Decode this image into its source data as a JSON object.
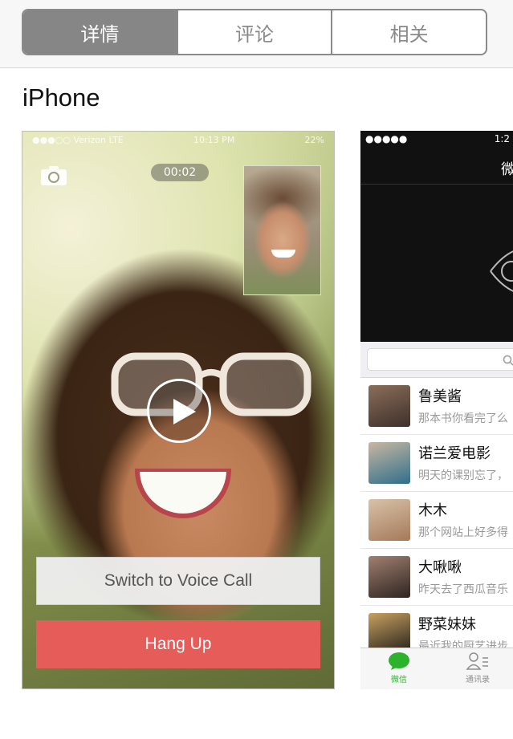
{
  "segment": {
    "tabs": [
      {
        "label": "详情",
        "active": true
      },
      {
        "label": "评论",
        "active": false
      },
      {
        "label": "相关",
        "active": false
      }
    ]
  },
  "section": {
    "title": "iPhone"
  },
  "screenshot1": {
    "status_left": "●●●○○ Verizon  LTE",
    "status_time": "10:13 PM",
    "status_right": "22%",
    "timer": "00:02",
    "switch_label": "Switch to Voice Call",
    "hangup_label": "Hang Up",
    "icons": {
      "camera": "camera-flip-icon",
      "play": "play-icon"
    }
  },
  "screenshot2": {
    "status_left": "●●●●● ",
    "status_time": "1:2",
    "title": "微",
    "chats": [
      {
        "name": "鲁美酱",
        "preview": "那本书你看完了么",
        "avatar_color": "#5a4a3e"
      },
      {
        "name": "诺兰爱电影",
        "preview": "明天的课别忘了，",
        "avatar_color": "#2f6f8c"
      },
      {
        "name": "木木",
        "preview": "那个网站上好多得",
        "avatar_color": "#b48a6a"
      },
      {
        "name": "大啾啾",
        "preview": "昨天去了西瓜音乐",
        "avatar_color": "#4b3a33"
      },
      {
        "name": "野菜妹妹",
        "preview": "最近我的厨艺进步",
        "avatar_color": "#2c2a24"
      }
    ],
    "tabs": [
      {
        "label": "微信",
        "icon": "chat-bubble-icon",
        "color": "#2bb32b"
      },
      {
        "label": "通讯录",
        "icon": "contacts-icon",
        "color": "#8e8e8e"
      }
    ],
    "accent": "#2bb32b"
  }
}
